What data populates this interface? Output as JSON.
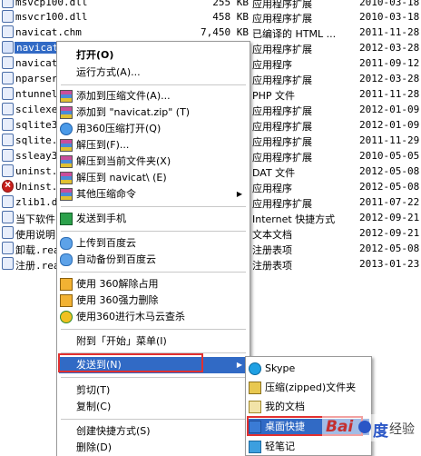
{
  "files": [
    {
      "name": "msvcp100.dll",
      "size": "255 KB",
      "type": "应用程序扩展",
      "date": "2010-03-18"
    },
    {
      "name": "msvcr100.dll",
      "size": "458 KB",
      "type": "应用程序扩展",
      "date": "2010-03-18"
    },
    {
      "name": "navicat.chm",
      "size": "7,450 KB",
      "type": "已编译的 HTML ...",
      "date": "2011-11-28"
    },
    {
      "name": "navicat.dll",
      "size": "",
      "type": "应用程序扩展",
      "date": "2012-03-28"
    },
    {
      "name": "navicat",
      "size": "",
      "type": "应用程序",
      "date": "2011-09-12"
    },
    {
      "name": "nparser.",
      "size": "",
      "type": "应用程序扩展",
      "date": "2012-03-28"
    },
    {
      "name": "ntunnel_",
      "size": "",
      "type": "PHP 文件",
      "date": "2011-11-28"
    },
    {
      "name": "scilexer",
      "size": "",
      "type": "应用程序扩展",
      "date": "2012-01-09"
    },
    {
      "name": "sqlite3.",
      "size": "",
      "type": "应用程序扩展",
      "date": "2012-01-09"
    },
    {
      "name": "sqlite.",
      "size": "",
      "type": "应用程序扩展",
      "date": "2011-11-29"
    },
    {
      "name": "ssleay32",
      "size": "",
      "type": "应用程序扩展",
      "date": "2010-05-05"
    },
    {
      "name": "uninst.",
      "size": "",
      "type": "DAT 文件",
      "date": "2012-05-08"
    },
    {
      "name": "Uninst.",
      "size": "",
      "type": "应用程序",
      "date": "2012-05-08"
    },
    {
      "name": "zlib1.dl",
      "size": "",
      "type": "应用程序扩展",
      "date": "2011-07-22"
    },
    {
      "name": "当下软件",
      "size": "",
      "type": "Internet 快捷方式",
      "date": "2012-09-21"
    },
    {
      "name": "使用说明",
      "size": "",
      "type": "文本文档",
      "date": "2012-09-21"
    },
    {
      "name": "卸载.rea",
      "size": "",
      "type": "注册表项",
      "date": "2012-05-08"
    },
    {
      "name": "注册.rea",
      "size": "",
      "type": "注册表项",
      "date": "2013-01-23"
    }
  ],
  "context_menu": {
    "open": "打开(O)",
    "run_as": "运行方式(A)...",
    "add_archive": "添加到压缩文件(A)...",
    "add_to_zip": "添加到 \"navicat.zip\" (T)",
    "open_360zip": "用360压缩打开(Q)",
    "extract_to": "解压到(F)...",
    "extract_here": "解压到当前文件夹(X)",
    "extract_to_navicat": "解压到 navicat\\ (E)",
    "other_commands": "其他压缩命令",
    "send_to_phone": "发送到手机",
    "upload_baidu": "上传到百度云",
    "auto_backup_baidu": "自动备份到百度云",
    "unlock_360": "使用 360解除占用",
    "force_delete_360": "使用 360强力删除",
    "trojan_scan_360": "使用360进行木马云查杀",
    "pin_start": "附到「开始」菜单(I)",
    "send_to": "发送到(N)",
    "cut": "剪切(T)",
    "copy": "复制(C)",
    "create_shortcut": "创建快捷方式(S)",
    "delete": "删除(D)"
  },
  "submenu": {
    "skype": "Skype",
    "zip_folder": "压缩(zipped)文件夹",
    "my_documents": "我的文档",
    "desktop_shortcut": "桌面快捷",
    "quick_notes": "轻笔记"
  },
  "watermark": {
    "bai": "Bai",
    "du": "度",
    "jingyan": "经验"
  },
  "colors": {
    "selection": "#316ac5",
    "highlight_box": "#e23030",
    "menu_border": "#9a9a9a"
  }
}
